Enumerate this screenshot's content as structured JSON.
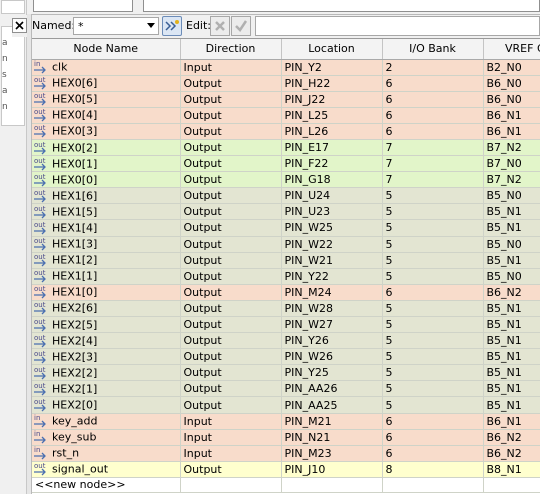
{
  "toolbar": {
    "named_label": "Named:",
    "named_value": "*",
    "edit_label": "Edit:"
  },
  "left_strip": {
    "items": [
      "a",
      "n",
      "s",
      "a",
      "n"
    ]
  },
  "table": {
    "columns": [
      "Node Name",
      "Direction",
      "Location",
      "I/O Bank",
      "VREF Gr"
    ],
    "rows": [
      {
        "icon": "in",
        "name": "clk",
        "direction": "Input",
        "location": "PIN_Y2",
        "bank": "2",
        "vref": "B2_N0",
        "group": "peach"
      },
      {
        "icon": "out",
        "name": "HEX0[6]",
        "direction": "Output",
        "location": "PIN_H22",
        "bank": "6",
        "vref": "B6_N0",
        "group": "peach"
      },
      {
        "icon": "out",
        "name": "HEX0[5]",
        "direction": "Output",
        "location": "PIN_J22",
        "bank": "6",
        "vref": "B6_N0",
        "group": "peach"
      },
      {
        "icon": "out",
        "name": "HEX0[4]",
        "direction": "Output",
        "location": "PIN_L25",
        "bank": "6",
        "vref": "B6_N1",
        "group": "peach"
      },
      {
        "icon": "out",
        "name": "HEX0[3]",
        "direction": "Output",
        "location": "PIN_L26",
        "bank": "6",
        "vref": "B6_N1",
        "group": "peach"
      },
      {
        "icon": "out",
        "name": "HEX0[2]",
        "direction": "Output",
        "location": "PIN_E17",
        "bank": "7",
        "vref": "B7_N2",
        "group": "green"
      },
      {
        "icon": "out",
        "name": "HEX0[1]",
        "direction": "Output",
        "location": "PIN_F22",
        "bank": "7",
        "vref": "B7_N0",
        "group": "green"
      },
      {
        "icon": "out",
        "name": "HEX0[0]",
        "direction": "Output",
        "location": "PIN_G18",
        "bank": "7",
        "vref": "B7_N2",
        "group": "green"
      },
      {
        "icon": "out",
        "name": "HEX1[6]",
        "direction": "Output",
        "location": "PIN_U24",
        "bank": "5",
        "vref": "B5_N0",
        "group": "olive"
      },
      {
        "icon": "out",
        "name": "HEX1[5]",
        "direction": "Output",
        "location": "PIN_U23",
        "bank": "5",
        "vref": "B5_N1",
        "group": "olive"
      },
      {
        "icon": "out",
        "name": "HEX1[4]",
        "direction": "Output",
        "location": "PIN_W25",
        "bank": "5",
        "vref": "B5_N1",
        "group": "olive"
      },
      {
        "icon": "out",
        "name": "HEX1[3]",
        "direction": "Output",
        "location": "PIN_W22",
        "bank": "5",
        "vref": "B5_N0",
        "group": "olive"
      },
      {
        "icon": "out",
        "name": "HEX1[2]",
        "direction": "Output",
        "location": "PIN_W21",
        "bank": "5",
        "vref": "B5_N1",
        "group": "olive"
      },
      {
        "icon": "out",
        "name": "HEX1[1]",
        "direction": "Output",
        "location": "PIN_Y22",
        "bank": "5",
        "vref": "B5_N0",
        "group": "olive"
      },
      {
        "icon": "out",
        "name": "HEX1[0]",
        "direction": "Output",
        "location": "PIN_M24",
        "bank": "6",
        "vref": "B6_N2",
        "group": "peach"
      },
      {
        "icon": "out",
        "name": "HEX2[6]",
        "direction": "Output",
        "location": "PIN_W28",
        "bank": "5",
        "vref": "B5_N1",
        "group": "olive"
      },
      {
        "icon": "out",
        "name": "HEX2[5]",
        "direction": "Output",
        "location": "PIN_W27",
        "bank": "5",
        "vref": "B5_N1",
        "group": "olive"
      },
      {
        "icon": "out",
        "name": "HEX2[4]",
        "direction": "Output",
        "location": "PIN_Y26",
        "bank": "5",
        "vref": "B5_N1",
        "group": "olive"
      },
      {
        "icon": "out",
        "name": "HEX2[3]",
        "direction": "Output",
        "location": "PIN_W26",
        "bank": "5",
        "vref": "B5_N1",
        "group": "olive"
      },
      {
        "icon": "out",
        "name": "HEX2[2]",
        "direction": "Output",
        "location": "PIN_Y25",
        "bank": "5",
        "vref": "B5_N1",
        "group": "olive"
      },
      {
        "icon": "out",
        "name": "HEX2[1]",
        "direction": "Output",
        "location": "PIN_AA26",
        "bank": "5",
        "vref": "B5_N1",
        "group": "olive"
      },
      {
        "icon": "out",
        "name": "HEX2[0]",
        "direction": "Output",
        "location": "PIN_AA25",
        "bank": "5",
        "vref": "B5_N1",
        "group": "olive"
      },
      {
        "icon": "in",
        "name": "key_add",
        "direction": "Input",
        "location": "PIN_M21",
        "bank": "6",
        "vref": "B6_N1",
        "group": "peach"
      },
      {
        "icon": "in",
        "name": "key_sub",
        "direction": "Input",
        "location": "PIN_N21",
        "bank": "6",
        "vref": "B6_N2",
        "group": "peach"
      },
      {
        "icon": "in",
        "name": "rst_n",
        "direction": "Input",
        "location": "PIN_M23",
        "bank": "6",
        "vref": "B6_N2",
        "group": "peach"
      },
      {
        "icon": "out",
        "name": "signal_out",
        "direction": "Output",
        "location": "PIN_J10",
        "bank": "8",
        "vref": "B8_N1",
        "group": "yellow"
      }
    ],
    "new_node_label": "<<new node>>"
  },
  "colors": {
    "peach": "#f8dccb",
    "green": "#e2f5c9",
    "olive": "#e3e5d2",
    "yellow": "#ffffce"
  }
}
